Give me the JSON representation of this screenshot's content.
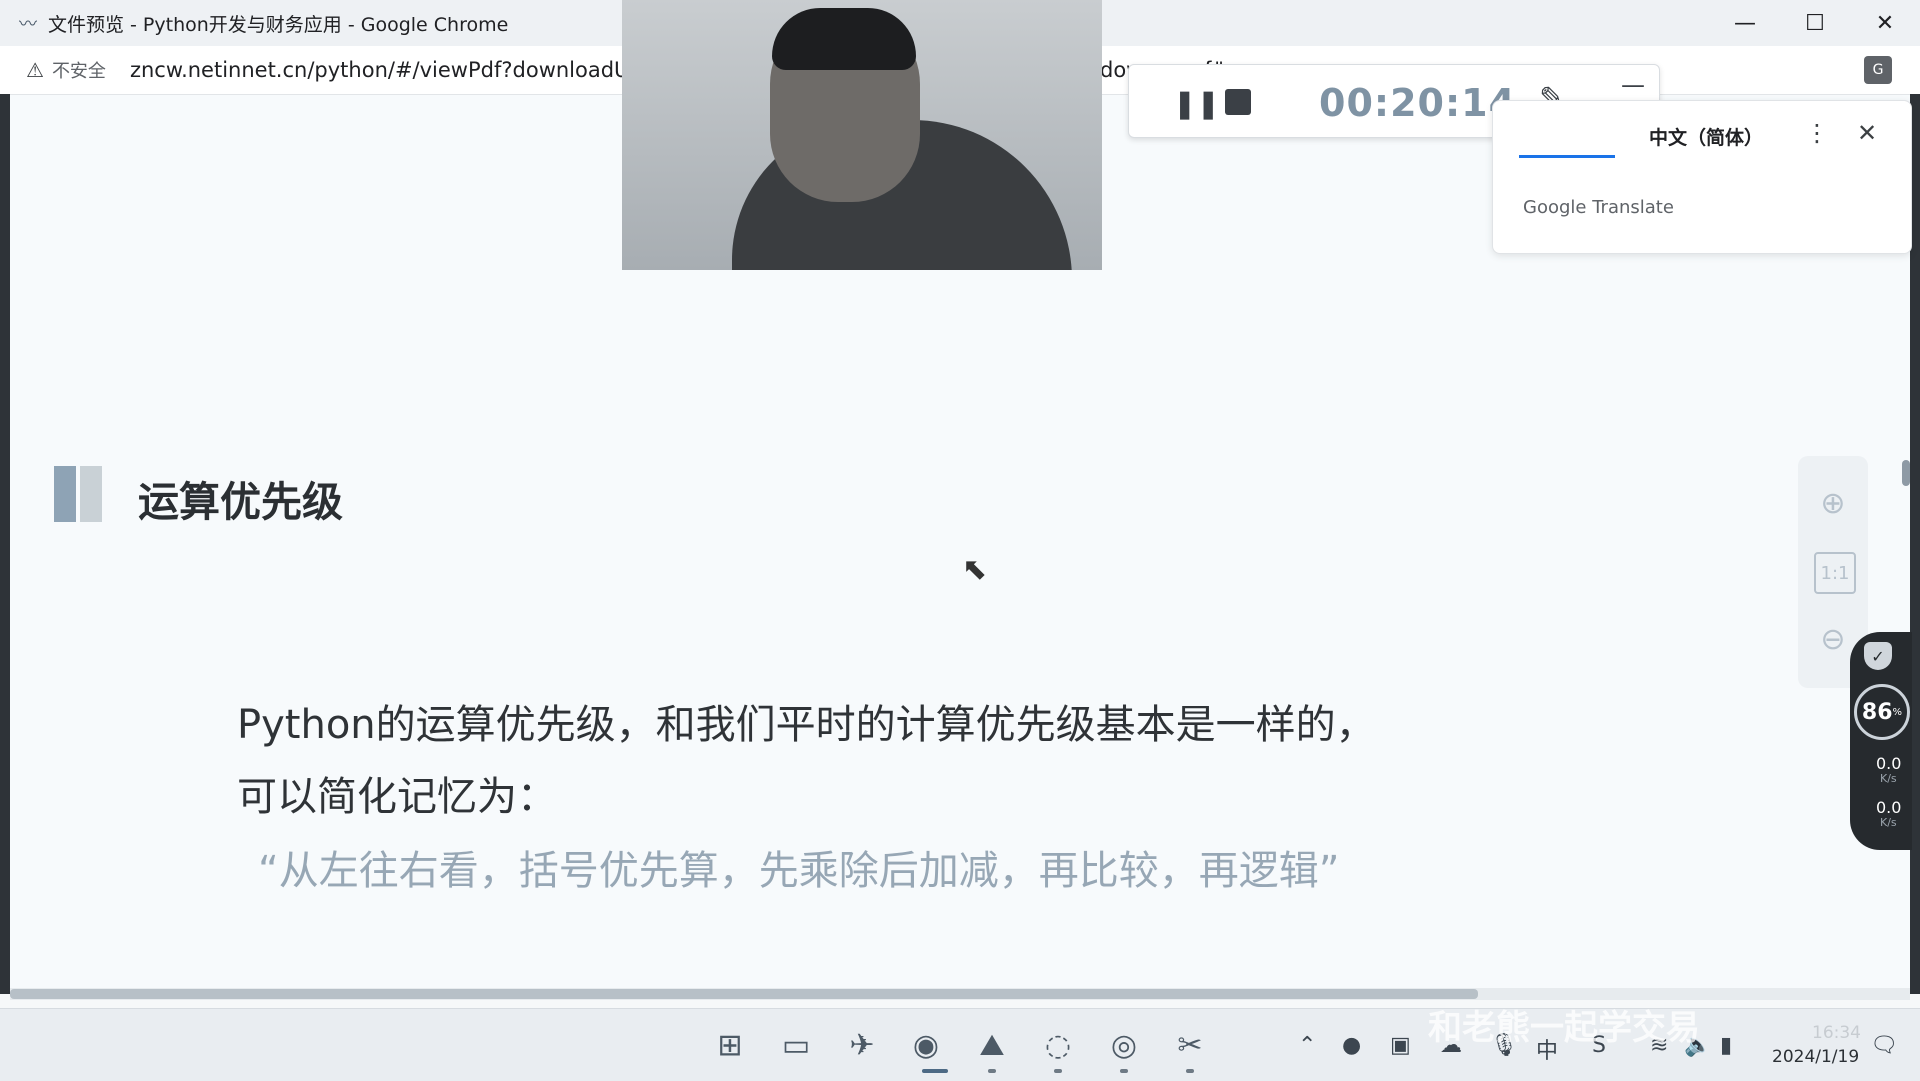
{
  "window": {
    "title": "文件预览 - Python开发与财务应用 - Google Chrome",
    "controls": {
      "minimize": "—",
      "maximize": "☐",
      "close": "✕"
    }
  },
  "addressbar": {
    "security_label": "不安全",
    "url": "zncw.netinnet.cn/python/#/viewPdf?downloadUr",
    "url_tail": "dow                                                         am={\"courseware..."
  },
  "slide": {
    "heading": "运算优先级",
    "line1": "Python的运算优先级，和我们平时的计算优先级基本是一样的，",
    "line2": "可以简化记忆为：",
    "quote": "“从左往右看，括号优先算，先乘除后加减，再比较，再逻辑”"
  },
  "recorder": {
    "timer": "00:20:14"
  },
  "translate_panel": {
    "target_language": "中文（简体）",
    "brand": "Google Translate"
  },
  "net_widget": {
    "percent": "86",
    "percent_unit": "%",
    "upload": "0.0",
    "download": "0.0",
    "unit": "K/s"
  },
  "taskbar": {
    "time": "16:34",
    "date": "2024/1/19",
    "watermark": "和老熊一起学交易"
  },
  "colors": {
    "heading_accent": "#8ea3b5",
    "quote": "#97a7b5",
    "timer": "#7f93a4"
  }
}
